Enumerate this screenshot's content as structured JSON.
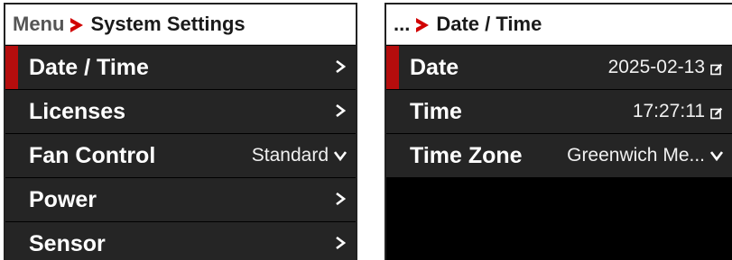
{
  "left": {
    "breadcrumb_root": "Menu",
    "title": "System Settings",
    "items": [
      {
        "label": "Date / Time",
        "value": "",
        "control": "chevron-right-icon"
      },
      {
        "label": "Licenses",
        "value": "",
        "control": "chevron-right-icon"
      },
      {
        "label": "Fan Control",
        "value": "Standard",
        "control": "chevron-down-icon"
      },
      {
        "label": "Power",
        "value": "",
        "control": "chevron-right-icon"
      },
      {
        "label": "Sensor",
        "value": "",
        "control": "chevron-right-icon"
      }
    ]
  },
  "right": {
    "breadcrumb_root": "...",
    "title": "Date / Time",
    "items": [
      {
        "label": "Date",
        "value": "2025-02-13",
        "control": "edit-icon"
      },
      {
        "label": "Time",
        "value": "17:27:11",
        "control": "edit-icon"
      },
      {
        "label": "Time Zone",
        "value": "Greenwich Me...",
        "control": "chevron-down-icon"
      }
    ]
  },
  "glyphs": {
    "chevron_right": "›",
    "chevron_down": "⌄"
  },
  "colors": {
    "accent": "#d10000",
    "selection_bar": "#b50d0d",
    "row_background": "#252525",
    "screen_background": "#000000",
    "header_background": "#ffffff"
  }
}
